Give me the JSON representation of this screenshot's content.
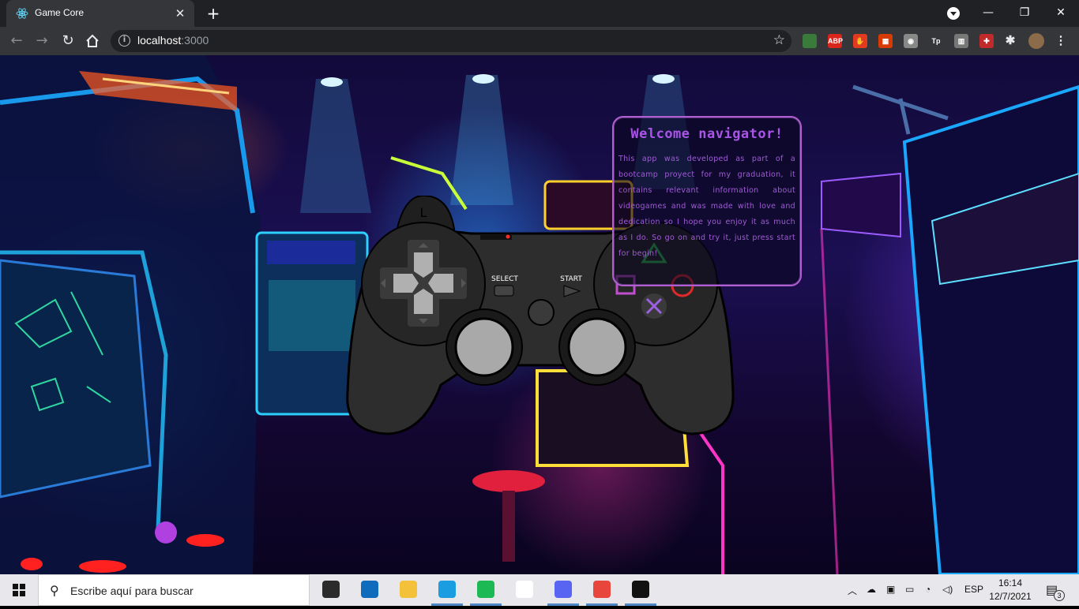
{
  "browser": {
    "tab_title": "Game Core",
    "tab_close": "✕",
    "new_tab": "+",
    "url_host": "localhost",
    "url_port": ":3000",
    "window_controls": [
      "—",
      "❐",
      "✕"
    ],
    "extensions": [
      {
        "name": "gem-icon",
        "text": "",
        "color": "#3a7a3a"
      },
      {
        "name": "adblock-icon",
        "text": "ABP",
        "color": "#d9251c"
      },
      {
        "name": "hand-icon",
        "text": "✋",
        "color": "#e03a22"
      },
      {
        "name": "office-icon",
        "text": "▦",
        "color": "#d83b01"
      },
      {
        "name": "compass-icon",
        "text": "◉",
        "color": "#888888"
      },
      {
        "name": "tp-icon",
        "text": "Tp",
        "color": "#35363a"
      },
      {
        "name": "barcode-icon",
        "text": "▥",
        "color": "#777777"
      },
      {
        "name": "puzzle-red-icon",
        "text": "✚",
        "color": "#c02a2a"
      }
    ]
  },
  "page": {
    "welcome_title": "Welcome navigator!",
    "welcome_body": "This app was developed as part of a bootcamp proyect for my graduation, it contains relevant information about videogames and was made with love and dedication so I hope you enjoy it as much as I do. So go on and try it, just press start for begin!",
    "controller": {
      "shoulder_label": "L",
      "select_label": "SELECT",
      "start_label": "START"
    }
  },
  "taskbar": {
    "search_placeholder": "Escribe aquí para buscar",
    "language": "ESP",
    "time": "16:14",
    "date": "12/7/2021",
    "notification_count": "3",
    "apps": [
      {
        "name": "store-app",
        "color": "#2b2b2b"
      },
      {
        "name": "mail-app",
        "color": "#0f6cbd"
      },
      {
        "name": "explorer-app",
        "color": "#f3c13a"
      },
      {
        "name": "edge-app",
        "color": "#1b9de2"
      },
      {
        "name": "spotify-app",
        "color": "#1db954"
      },
      {
        "name": "slack-app",
        "color": "#ffffff"
      },
      {
        "name": "discord-app",
        "color": "#5865f2"
      },
      {
        "name": "chrome-app",
        "color": "#e8453c"
      },
      {
        "name": "terminal-app",
        "color": "#111111"
      }
    ]
  }
}
